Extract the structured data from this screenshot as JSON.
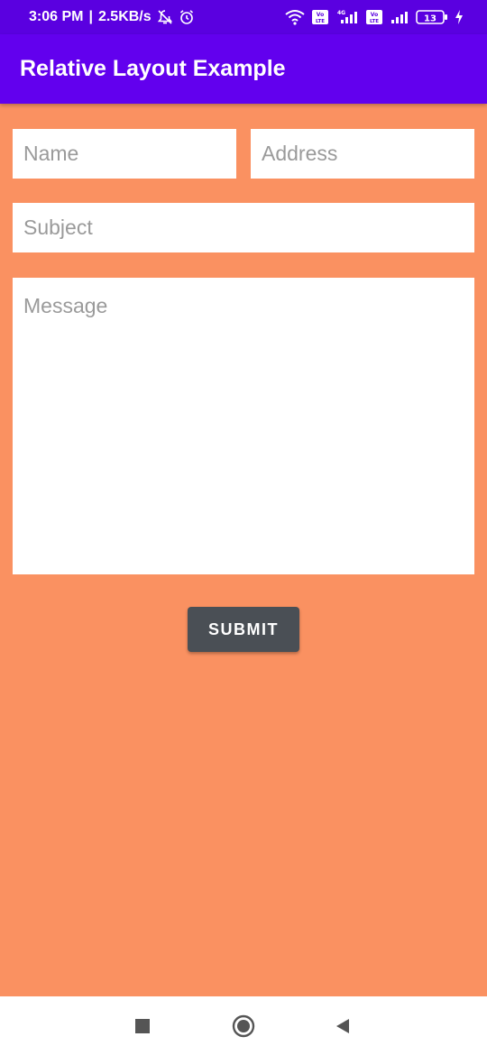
{
  "status_bar": {
    "time": "3:06 PM",
    "separator": "|",
    "network_speed": "2.5KB/s",
    "icons": [
      "alarm-off-icon",
      "alarm-icon",
      "wifi-icon",
      "volte-icon",
      "signal-4g-icon",
      "volte-icon",
      "signal-icon",
      "battery-icon",
      "charging-icon"
    ],
    "volte_label": "Vo LTE",
    "network_type": "4G",
    "battery_level": "13"
  },
  "app_bar": {
    "title": "Relative Layout Example",
    "color": "#6200ee"
  },
  "form": {
    "name_placeholder": "Name",
    "address_placeholder": "Address",
    "subject_placeholder": "Subject",
    "message_placeholder": "Message",
    "submit_label": "SUBMIT",
    "background_color": "#fa9161"
  },
  "nav_bar": {
    "icons": [
      "recents-square-icon",
      "home-circle-icon",
      "back-triangle-icon"
    ]
  }
}
